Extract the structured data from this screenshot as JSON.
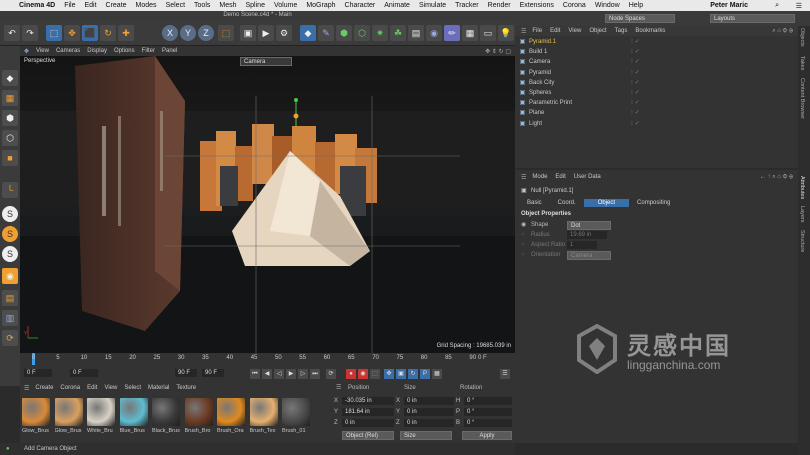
{
  "menubar": {
    "app": "Cinema 4D",
    "items": [
      "File",
      "Edit",
      "Create",
      "Modes",
      "Select",
      "Tools",
      "Mesh",
      "Spline",
      "Volume",
      "MoGraph",
      "Character",
      "Animate",
      "Simulate",
      "Tracker",
      "Render",
      "Extensions",
      "Corona",
      "Window",
      "Help"
    ],
    "user": "Peter Maric"
  },
  "window_title": "Demo Scene.c4d * - Main",
  "layout": {
    "node_spaces": "Node Spaces",
    "layouts": "Layouts"
  },
  "viewport": {
    "menu": [
      "View",
      "Cameras",
      "Display",
      "Options",
      "Filter",
      "Panel"
    ],
    "label": "Perspective",
    "camera": "Camera",
    "grid_spacing": "Grid Spacing : 19685.039 in"
  },
  "timeline": {
    "ticks": [
      "0",
      "5",
      "10",
      "15",
      "20",
      "25",
      "30",
      "35",
      "40",
      "45",
      "50",
      "55",
      "60",
      "65",
      "70",
      "75",
      "80",
      "85",
      "90"
    ],
    "current_frame": "0 F",
    "start": "0 F",
    "start2": "0 F",
    "end": "90 F",
    "end2": "90 F"
  },
  "materials": {
    "menu": [
      "Create",
      "Corona",
      "Edit",
      "View",
      "Select",
      "Material",
      "Texture"
    ],
    "items": [
      {
        "name": "Glow_Brus",
        "color": "#d98a3a"
      },
      {
        "name": "Glow_Brus",
        "color": "#d9a060"
      },
      {
        "name": "White_Bru",
        "color": "#d8d2c6"
      },
      {
        "name": "Blue_Brus",
        "color": "#5fbcd0"
      },
      {
        "name": "Black_Brus",
        "color": "#3a3a3a"
      },
      {
        "name": "Brush_Bro",
        "color": "#6e3a22"
      },
      {
        "name": "Brush_Ora",
        "color": "#e08a20"
      },
      {
        "name": "Brush_Tex",
        "color": "#e6b070"
      },
      {
        "name": "Brush_01",
        "color": "#4a4a4a"
      }
    ]
  },
  "coords": {
    "headers": {
      "position": "Position",
      "size": "Size",
      "rotation": "Rotation"
    },
    "x_label": "X",
    "y_label": "Y",
    "z_label": "Z",
    "x_pos": "-30.035 in",
    "y_pos": "181.64 in",
    "z_pos": "0 in",
    "x_size": "0 in",
    "y_size": "0 in",
    "z_size": "0 in",
    "h_label": "H",
    "p_label": "P",
    "b_label": "B",
    "h_rot": "0 °",
    "p_rot": "0 °",
    "b_rot": "0 °",
    "mode": "Object (Rel)",
    "size_mode": "Size",
    "apply": "Apply"
  },
  "status": "Add Camera Object",
  "object_manager": {
    "menu": [
      "File",
      "Edit",
      "View",
      "Object",
      "Tags",
      "Bookmarks"
    ],
    "objects": [
      {
        "name": "Pyramid.1",
        "color": "#e6c34a"
      },
      {
        "name": "Build 1",
        "color": "#c8c8c8"
      },
      {
        "name": "Camera",
        "color": "#c8c8c8"
      },
      {
        "name": "Pyramid",
        "color": "#c8c8c8"
      },
      {
        "name": "Back City",
        "color": "#c8c8c8"
      },
      {
        "name": "Spheres",
        "color": "#c8c8c8"
      },
      {
        "name": "Parametric Print",
        "color": "#c8c8c8"
      },
      {
        "name": "Plane",
        "color": "#c8c8c8"
      },
      {
        "name": "Light",
        "color": "#c8c8c8"
      }
    ]
  },
  "attributes": {
    "menu": [
      "Mode",
      "Edit",
      "User Data"
    ],
    "object_name": "Null [Pyramid.1]",
    "tabs": [
      "Basic",
      "Coord.",
      "Object",
      "Compositing"
    ],
    "active_tab": "Object",
    "section": "Object Properties",
    "shape_label": "Shape",
    "shape_value": "Dot",
    "radius_label": "Radius",
    "radius_value": "19.69 in",
    "aspect_label": "Aspect Ratio",
    "aspect_value": "1",
    "orientation_label": "Orientation",
    "orientation_value": "Camera"
  },
  "right_tabs": [
    "Objects",
    "Takes",
    "Content Browser",
    "Attributes",
    "Layers",
    "Structure"
  ],
  "watermark": {
    "cn": "灵感中国",
    "url": "lingganchina.com"
  }
}
